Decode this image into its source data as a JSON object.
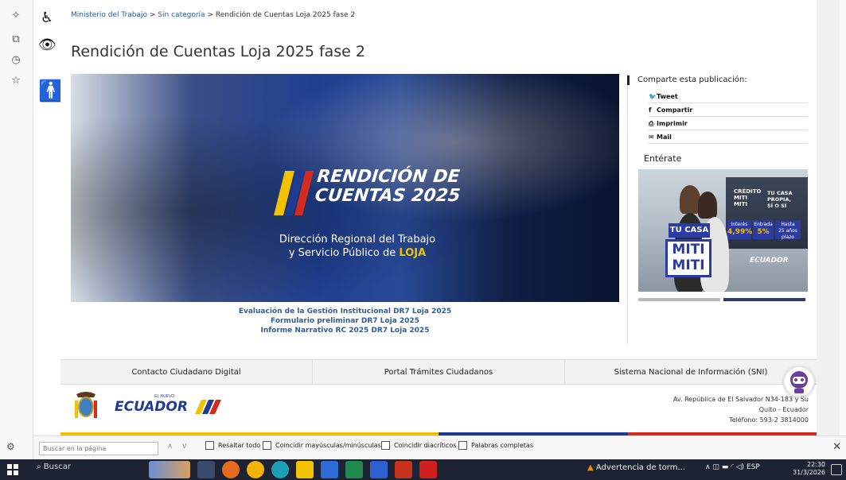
{
  "breadcrumb": {
    "home": "Ministerio del Trabajo",
    "sep1": ">",
    "category": "Sin categoría",
    "sep2": ">",
    "current": "Rendición de Cuentas Loja 2025 fase 2"
  },
  "page_title": "Rendición de Cuentas Loja 2025 fase 2",
  "hero": {
    "title_line1": "RENDICIÓN DE",
    "title_line2": "CUENTAS 2025",
    "subtitle_line1": "Dirección Regional del Trabajo",
    "subtitle_line2": "y Servicio Público de",
    "subtitle_highlight": "LOJA"
  },
  "links": [
    "Evaluación de la Gestión Institucional DR7 Loja 2025",
    "Formulario preliminar DR7 Loja 2025",
    "Informe Narrativo RC 2025 DR7 Loja 2025"
  ],
  "share": {
    "heading": "Comparte esta publicación:",
    "items": [
      {
        "icon": "twitter-icon",
        "glyph": "🐦",
        "label": "Tweet"
      },
      {
        "icon": "facebook-icon",
        "glyph": "f",
        "label": "Compartir"
      },
      {
        "icon": "print-icon",
        "glyph": "⎙",
        "label": "Imprimir"
      },
      {
        "icon": "mail-icon",
        "glyph": "✉",
        "label": "Mail"
      }
    ]
  },
  "enterate": "Entérate",
  "promo": {
    "t2": "CRÉDITO\nMITI\nMITI",
    "t1": "TU CASA\nPROPIA,\nSÍ O SÍ",
    "interes_label": "Interés",
    "interes": "4,99%",
    "entrada_label": "Entrada",
    "entrada": "5%",
    "hasta_label": "Hasta",
    "hasta": "25 años plazo",
    "sign1": "TU CASA",
    "sign2": "MITI\nMITI",
    "brand": "ECUADOR"
  },
  "footer_nav": [
    "Contacto Ciudadano Digital",
    "Portal Trámites Ciudadanos",
    "Sistema Nacional de Información (SNI)"
  ],
  "footer": {
    "logo": "ECUADOR",
    "logo_small": "EL NUEVO",
    "address_line1": "Av. República de El Salvador N34-183 y Su",
    "address_line2": "Quito - Ecuador",
    "address_line3": "Teléfono: 593-2 3814000"
  },
  "findbar": {
    "placeholder": "Buscar en la página",
    "options": [
      "Resaltar todo",
      "Coincidir mayúsculas/minúsculas",
      "Coincidir diacríticos",
      "Palabras completas"
    ]
  },
  "taskbar": {
    "search": "Buscar",
    "warning": "Advertencia de torm...",
    "lang": "ESP",
    "time": "22:30",
    "date": "31/3/2026"
  },
  "colors": {
    "link": "#2a5d9f",
    "flag_yellow": "#f2c200",
    "flag_blue": "#1f3b8f",
    "flag_red": "#d52b1e",
    "taskbar": "#1d2333"
  }
}
